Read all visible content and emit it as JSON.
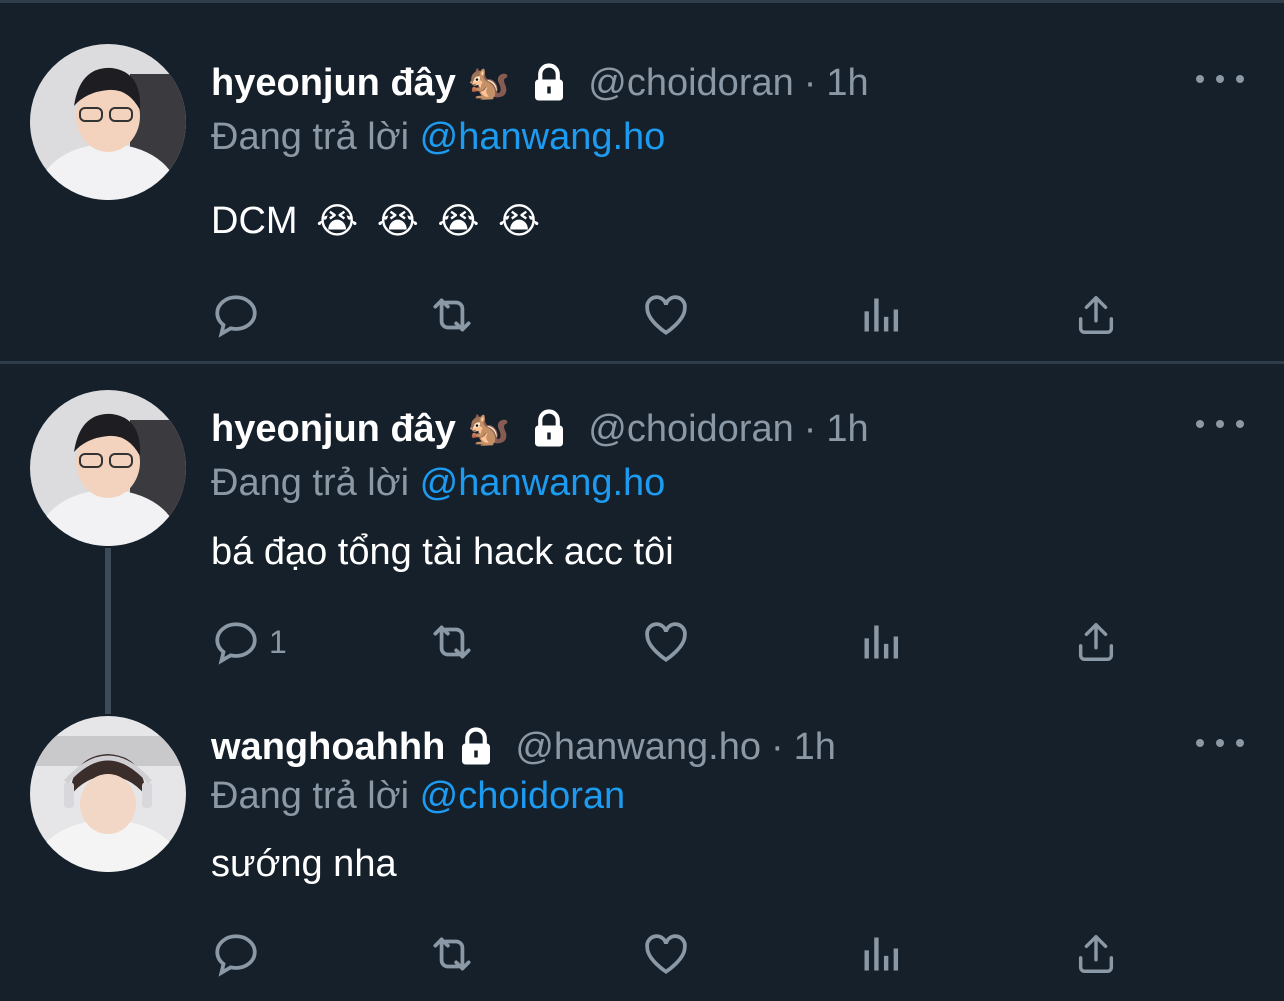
{
  "colors": {
    "background": "#15202b",
    "divider": "#2f3c49",
    "text_primary": "#ffffff",
    "text_secondary": "#8b98a5",
    "mention": "#1d9bf0"
  },
  "tweets": [
    {
      "display_name": "hyeonjun đây",
      "name_emoji": "🐿️",
      "handle": "@choidoran",
      "separator": "·",
      "time": "1h",
      "reply_prefix": "Đang trả lời",
      "reply_to": "@hanwang.ho",
      "text": "DCM",
      "text_emojis": [
        "😭",
        "😭",
        "😭",
        "😭"
      ],
      "reply_count": "",
      "avatar_icon": "user-avatar"
    },
    {
      "display_name": "hyeonjun đây",
      "name_emoji": "🐿️",
      "handle": "@choidoran",
      "separator": "·",
      "time": "1h",
      "reply_prefix": "Đang trả lời",
      "reply_to": "@hanwang.ho",
      "text": "bá đạo tổng tài hack acc tôi",
      "reply_count": "1",
      "avatar_icon": "user-avatar"
    },
    {
      "display_name": "wanghoahhh",
      "handle": "@hanwang.ho",
      "separator": "·",
      "time": "1h",
      "reply_prefix": "Đang trả lời",
      "reply_to": "@choidoran",
      "text": "sướng nha",
      "reply_count": "",
      "avatar_icon": "user-avatar"
    }
  ],
  "icons": {
    "reply": "reply-icon",
    "retweet": "retweet-icon",
    "like": "heart-icon",
    "views": "analytics-icon",
    "share": "share-icon",
    "lock": "lock-icon",
    "more": "more-icon"
  }
}
